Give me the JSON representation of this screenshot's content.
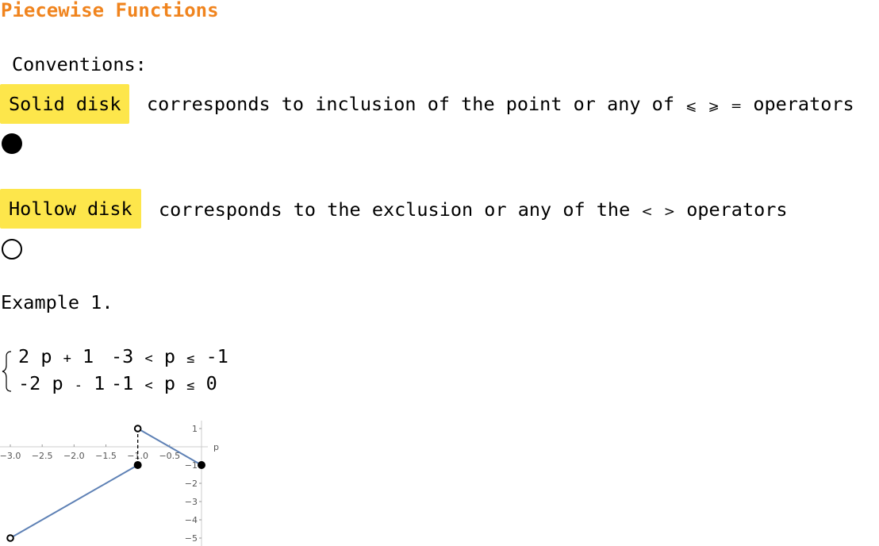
{
  "title": "Piecewise Functions",
  "conventions_label": "Conventions:",
  "solid": {
    "label": "Solid disk",
    "description_before": "corresponds to inclusion of the point or any of",
    "operators": [
      "⩽",
      "⩾",
      "="
    ],
    "description_after": "operators"
  },
  "hollow": {
    "label": "Hollow disk",
    "description_before": "corresponds to the exclusion or any of the",
    "operators": [
      "<",
      ">"
    ],
    "description_after": "operators"
  },
  "example": {
    "label": "Example 1.",
    "piecewise": [
      {
        "expr": [
          "2",
          "p",
          "+",
          "1"
        ],
        "cond": [
          "-3",
          "<",
          "p",
          "≤",
          "-1"
        ]
      },
      {
        "expr": [
          "-2",
          "p",
          "-",
          "1"
        ],
        "cond": [
          "-1",
          "<",
          "p",
          "≤",
          "0"
        ]
      }
    ]
  },
  "chart_data": {
    "type": "line",
    "xlabel": "p",
    "ylabel": "",
    "xlim": [
      -3.0,
      0.0
    ],
    "ylim": [
      -5,
      1
    ],
    "x_ticks": [
      "-3.0",
      "-2.5",
      "-2.0",
      "-1.5",
      "-1.0",
      "-0.5"
    ],
    "y_ticks": [
      "1",
      "-1",
      "-2",
      "-3",
      "-4",
      "-5"
    ],
    "series": [
      {
        "x": [
          -3,
          -1
        ],
        "y": [
          -5,
          -1
        ],
        "color": "#5e81b5"
      },
      {
        "x": [
          -1,
          0
        ],
        "y": [
          1,
          -1
        ],
        "color": "#5e81b5"
      }
    ],
    "points": [
      {
        "x": -3,
        "y": -5,
        "style": "hollow"
      },
      {
        "x": -1,
        "y": -1,
        "style": "solid"
      },
      {
        "x": -1,
        "y": 1,
        "style": "hollow"
      },
      {
        "x": 0,
        "y": -1,
        "style": "solid"
      }
    ],
    "dashed_segments": [
      {
        "x": [
          -1,
          -1
        ],
        "y": [
          -1,
          1
        ]
      }
    ]
  }
}
